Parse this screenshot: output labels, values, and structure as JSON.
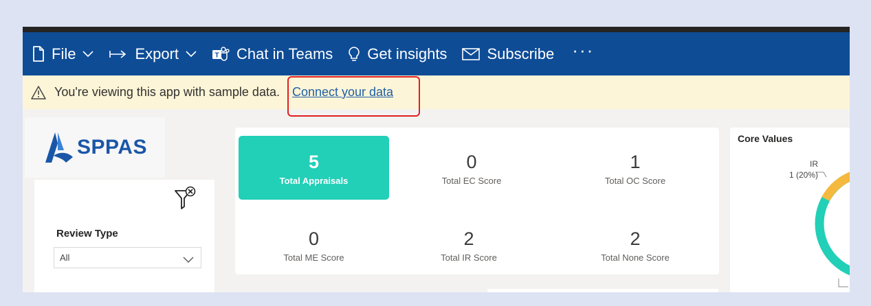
{
  "toolbar": {
    "file_label": "File",
    "export_label": "Export",
    "chat_label": "Chat in Teams",
    "insights_label": "Get insights",
    "subscribe_label": "Subscribe",
    "more_label": "···"
  },
  "banner": {
    "message": "You're viewing this app with sample data.",
    "link_label": "Connect your data"
  },
  "logo": {
    "text": "SPPAS"
  },
  "filter": {
    "review_type_label": "Review Type",
    "review_type_value": "All"
  },
  "kpis": {
    "total_appraisals": {
      "value": "5",
      "label": "Total Appraisals"
    },
    "total_ec": {
      "value": "0",
      "label": "Total EC Score"
    },
    "total_oc": {
      "value": "1",
      "label": "Total OC Score"
    },
    "total_me": {
      "value": "0",
      "label": "Total ME Score"
    },
    "total_ir": {
      "value": "2",
      "label": "Total IR Score"
    },
    "total_none": {
      "value": "2",
      "label": "Total None Score"
    }
  },
  "core_values": {
    "title": "Core Values",
    "ir_label": "IR",
    "ir_value": "1 (20%)"
  },
  "colors": {
    "toolbar_bg": "#0e4c96",
    "banner_bg": "#fdf5d7",
    "accent_teal": "#22cfb7",
    "donut_orange": "#f4b93e",
    "highlight_red": "#e02020"
  }
}
